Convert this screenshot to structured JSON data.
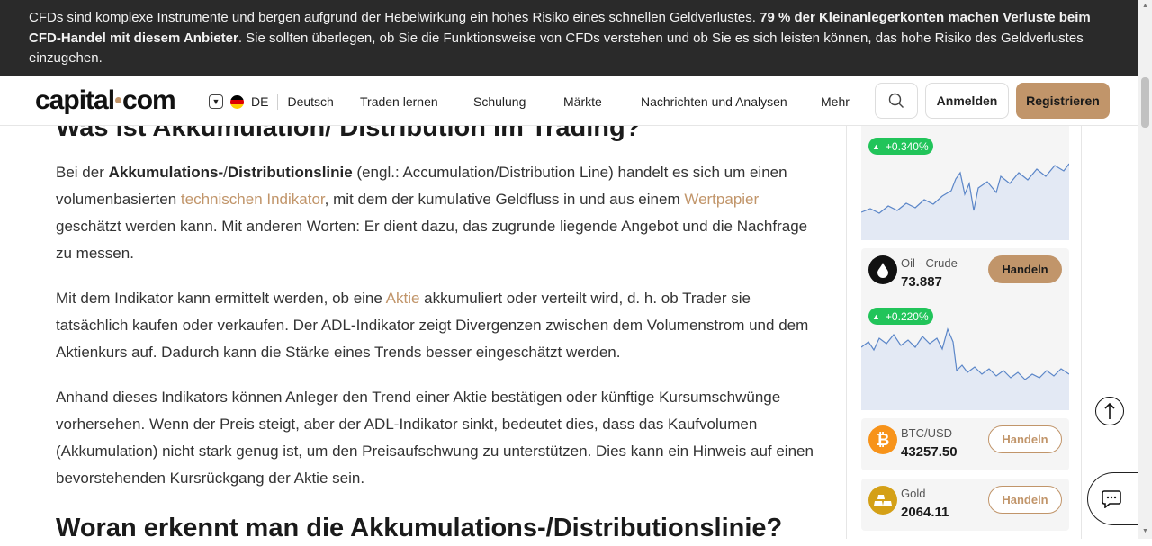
{
  "risk_banner": {
    "text_part1": "CFDs sind komplexe Instrumente und bergen aufgrund der Hebelwirkung ein hohes Risiko eines schnellen Geldverlustes. ",
    "text_bold": "79 % der Kleinanlegerkonten machen Verluste beim CFD-Handel mit diesem Anbieter",
    "text_part2": ". Sie sollten überlegen, ob Sie die Funktionsweise von CFDs verstehen und ob Sie es sich leisten können, das hohe Risiko des Geldverlustes einzugehen."
  },
  "header": {
    "logo_left": "capital",
    "logo_right": "com",
    "lang_code": "DE",
    "lang_name": "Deutsch",
    "nav": [
      "Traden lernen",
      "Schulung",
      "Märkte",
      "Nachrichten und Analysen",
      "Mehr"
    ],
    "login_label": "Anmelden",
    "register_label": "Registrieren"
  },
  "article": {
    "heading_top": "Was ist Akkumulation/ Distribution im Trading?",
    "p1": {
      "t1": "Bei der ",
      "b1": "Akkumulations-",
      "t2": "/",
      "b2": "Distributionslinie",
      "t3": " (engl.: Accumulation/Distribution Line) handelt es sich um einen volumenbasierten ",
      "link1": "technischen Indikator",
      "t4": ", mit dem der kumulative Geldfluss in und aus einem ",
      "link2": "Wertpapier",
      "t5": " geschätzt werden kann. Mit anderen Worten: Er dient dazu, das zugrunde liegende Angebot und die Nachfrage zu messen."
    },
    "p2": {
      "t1": "Mit dem Indikator kann ermittelt werden, ob eine ",
      "link1": "Aktie",
      "t2": " akkumuliert oder verteilt wird, d. h. ob Trader sie tatsächlich kaufen oder verkaufen. Der ADL-Indikator zeigt Divergenzen zwischen dem Volumenstrom und dem Aktienkurs auf. Dadurch kann die Stärke eines Trends besser eingeschätzt werden."
    },
    "p3": "Anhand dieses Indikators können Anleger den Trend einer Aktie bestätigen oder künftige Kursumschwünge vorhersehen. Wenn der Preis steigt, aber der ADL-Indikator sinkt, bedeutet dies, dass das Kaufvolumen (Akkumulation) nicht stark genug ist, um den Preisaufschwung zu unterstützen. Dies kann ein Hinweis auf einen bevorstehenden Kursrückgang der Aktie sein.",
    "heading_bottom": "Woran erkennt man die Akkumulations-/Distributionslinie?"
  },
  "sidebar": {
    "card0": {
      "change": "+0.340%"
    },
    "card1": {
      "name": "Oil - Crude",
      "price": "73.887",
      "trade_label": "Handeln",
      "change": "+0.220%"
    },
    "card2": {
      "name": "BTC/USD",
      "price": "43257.50",
      "trade_label": "Handeln"
    },
    "card3": {
      "name": "Gold",
      "price": "2064.11",
      "trade_label": "Handeln"
    }
  },
  "colors": {
    "accent": "#c1956a",
    "positive": "#21c45a",
    "banner_bg": "#2a2a2a",
    "bitcoin": "#f7931a",
    "gold": "#d4a017"
  },
  "icons": [
    "search-icon",
    "chevron-down-icon",
    "flag-de-icon",
    "oil-drop-icon",
    "bitcoin-icon",
    "gold-bars-icon",
    "arrow-up-icon",
    "chat-icon",
    "caret-up-icon"
  ]
}
